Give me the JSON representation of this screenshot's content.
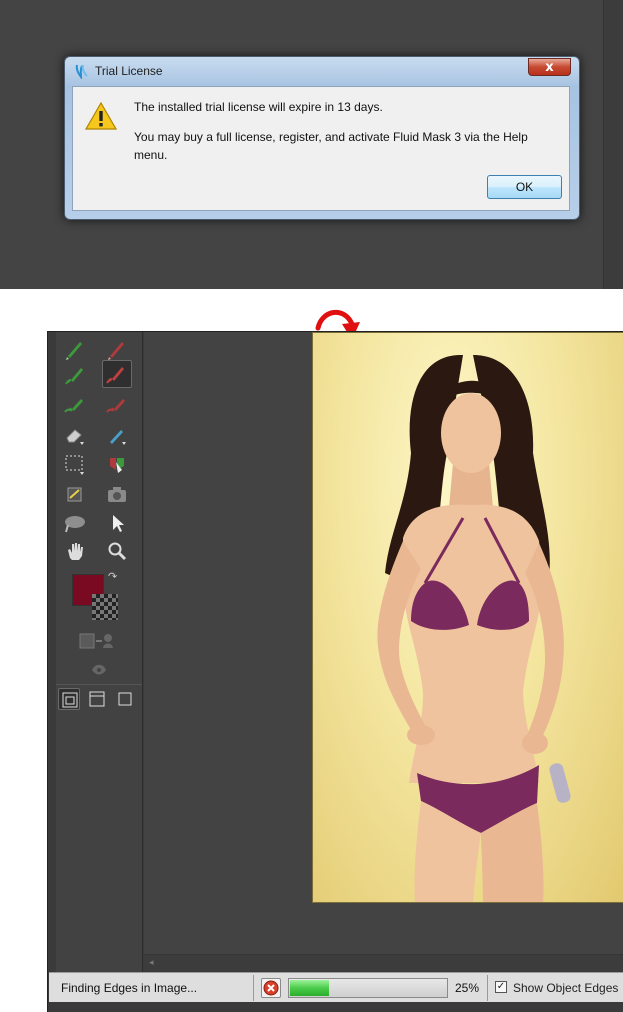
{
  "dialog": {
    "title": "Trial License",
    "close_glyph": "x",
    "message_line1": "The installed trial license will expire in 13 days.",
    "message_line2": "You may buy a full license, register, and activate Fluid Mask 3 via the Help menu.",
    "ok_label": "OK",
    "icons": {
      "app": "fluid-mask-icon",
      "warning": "warning-icon"
    }
  },
  "annotation": {
    "arrow_color": "#e01010"
  },
  "toolbox": {
    "tools": [
      "keep-brush",
      "delete-brush",
      "keep-local-brush",
      "delete-local-brush",
      "keep-exact-brush",
      "delete-exact-brush",
      "eraser",
      "blend-brush",
      "selection-tool",
      "fill-tool",
      "patch-tool",
      "camera-snapshot",
      "edge-tool",
      "pointer-tool",
      "hand-tool",
      "zoom-tool"
    ],
    "foreground_color": "#7a0a22",
    "view_modes": [
      "view-mode-1",
      "view-mode-2",
      "view-mode-3"
    ]
  },
  "statusbar": {
    "message": "Finding Edges in Image...",
    "progress_percent": 25,
    "progress_label": "25%",
    "show_object_edges_label": "Show Object Edges",
    "show_object_edges_checked": true
  }
}
